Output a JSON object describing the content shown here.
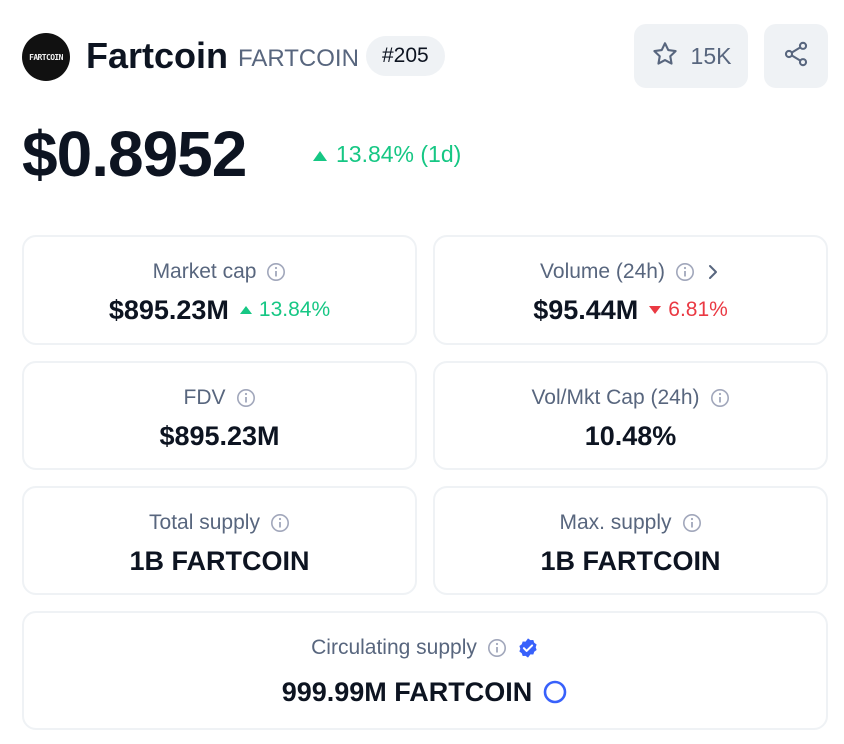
{
  "header": {
    "logo_text": "FARTCOIN",
    "name": "Fartcoin",
    "symbol": "FARTCOIN",
    "rank": "#205",
    "watchlist_count": "15K"
  },
  "price": {
    "value": "$0.8952",
    "change": "13.84% (1d)",
    "direction": "up"
  },
  "stats": {
    "market_cap": {
      "label": "Market cap",
      "value": "$895.23M",
      "change": "13.84%",
      "direction": "up"
    },
    "volume": {
      "label": "Volume (24h)",
      "value": "$95.44M",
      "change": "6.81%",
      "direction": "down"
    },
    "fdv": {
      "label": "FDV",
      "value": "$895.23M"
    },
    "vol_mkt_cap": {
      "label": "Vol/Mkt Cap (24h)",
      "value": "10.48%"
    },
    "total_supply": {
      "label": "Total supply",
      "value": "1B FARTCOIN"
    },
    "max_supply": {
      "label": "Max. supply",
      "value": "1B FARTCOIN"
    },
    "circulating_supply": {
      "label": "Circulating supply",
      "value": "999.99M FARTCOIN"
    }
  },
  "icons": {
    "watch": "star-icon",
    "share": "share-icon",
    "info": "info-icon",
    "verified": "verified-badge-icon",
    "progress": "ring-icon"
  },
  "colors": {
    "up": "#16c784",
    "down": "#ea3943",
    "text": "#0d1421",
    "muted": "#58667e",
    "button_bg": "#eff2f5",
    "verified": "#3861fb"
  }
}
